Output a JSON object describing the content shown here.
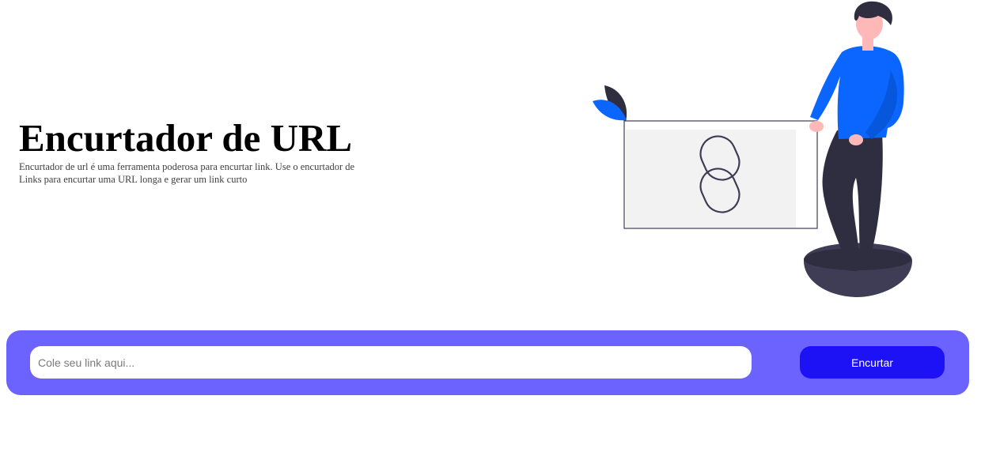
{
  "hero": {
    "title": "Encurtador de URL",
    "description": "Encurtador de url é uma ferramenta poderosa para encurtar link. Use o encurtador de Links para encurtar uma URL longa e gerar um link curto"
  },
  "form": {
    "placeholder": "Cole seu link aqui...",
    "value": "",
    "button_label": "Encurtar"
  },
  "illustration": {
    "icon": "chain-link-icon"
  },
  "colors": {
    "bar": "#6c63ff",
    "button": "#1c12f5",
    "shirt": "#0a66ff",
    "pants": "#2f2e41",
    "leaf_blue": "#0a66ff",
    "leaf_dark": "#2f2e41",
    "skin": "#ffb8b8",
    "hair": "#2f2e41"
  }
}
